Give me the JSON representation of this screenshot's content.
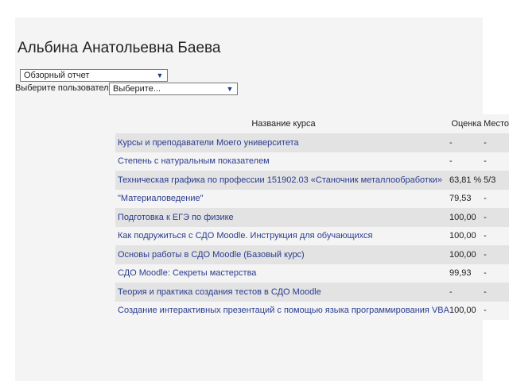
{
  "page": {
    "title": "Альбина Анатольевна Баева"
  },
  "controls": {
    "report_select": "Обзорный отчет",
    "user_label": "Выберите пользователя",
    "user_select": "Выберите..."
  },
  "table": {
    "headers": [
      "Название курса",
      "Оценка",
      "Место"
    ],
    "rows": [
      {
        "course": "Курсы и преподаватели Moeгo университета",
        "grade": "-",
        "rank": "-"
      },
      {
        "course": "Степень с натуральным показателем",
        "grade": "-",
        "rank": "-"
      },
      {
        "course": "Техническая графика по профессии 151902.03 «Станочник металлообработки»",
        "grade": "63,81 %",
        "rank": "5/3"
      },
      {
        "course": "\"Материаловедение\"",
        "grade": "79,53",
        "rank": "-"
      },
      {
        "course": "Подготовка к ЕГЭ по физике",
        "grade": "100,00",
        "rank": "-"
      },
      {
        "course": "Как подружиться с СДО Moodle. Инструкция для обучающихся",
        "grade": "100,00",
        "rank": "-"
      },
      {
        "course": "Основы работы в СДО Moodle (Базовый курс)",
        "grade": "100,00",
        "rank": "-"
      },
      {
        "course": "СДО Moodle: Секреты мастерства",
        "grade": "99,93",
        "rank": "-"
      },
      {
        "course": "Теория и практика создания тестов в СДО Moodle",
        "grade": "-",
        "rank": "-"
      },
      {
        "course": "Создание интерактивных презентаций с помощью языка программирования VBA",
        "grade": "100,00",
        "rank": "-"
      }
    ]
  }
}
